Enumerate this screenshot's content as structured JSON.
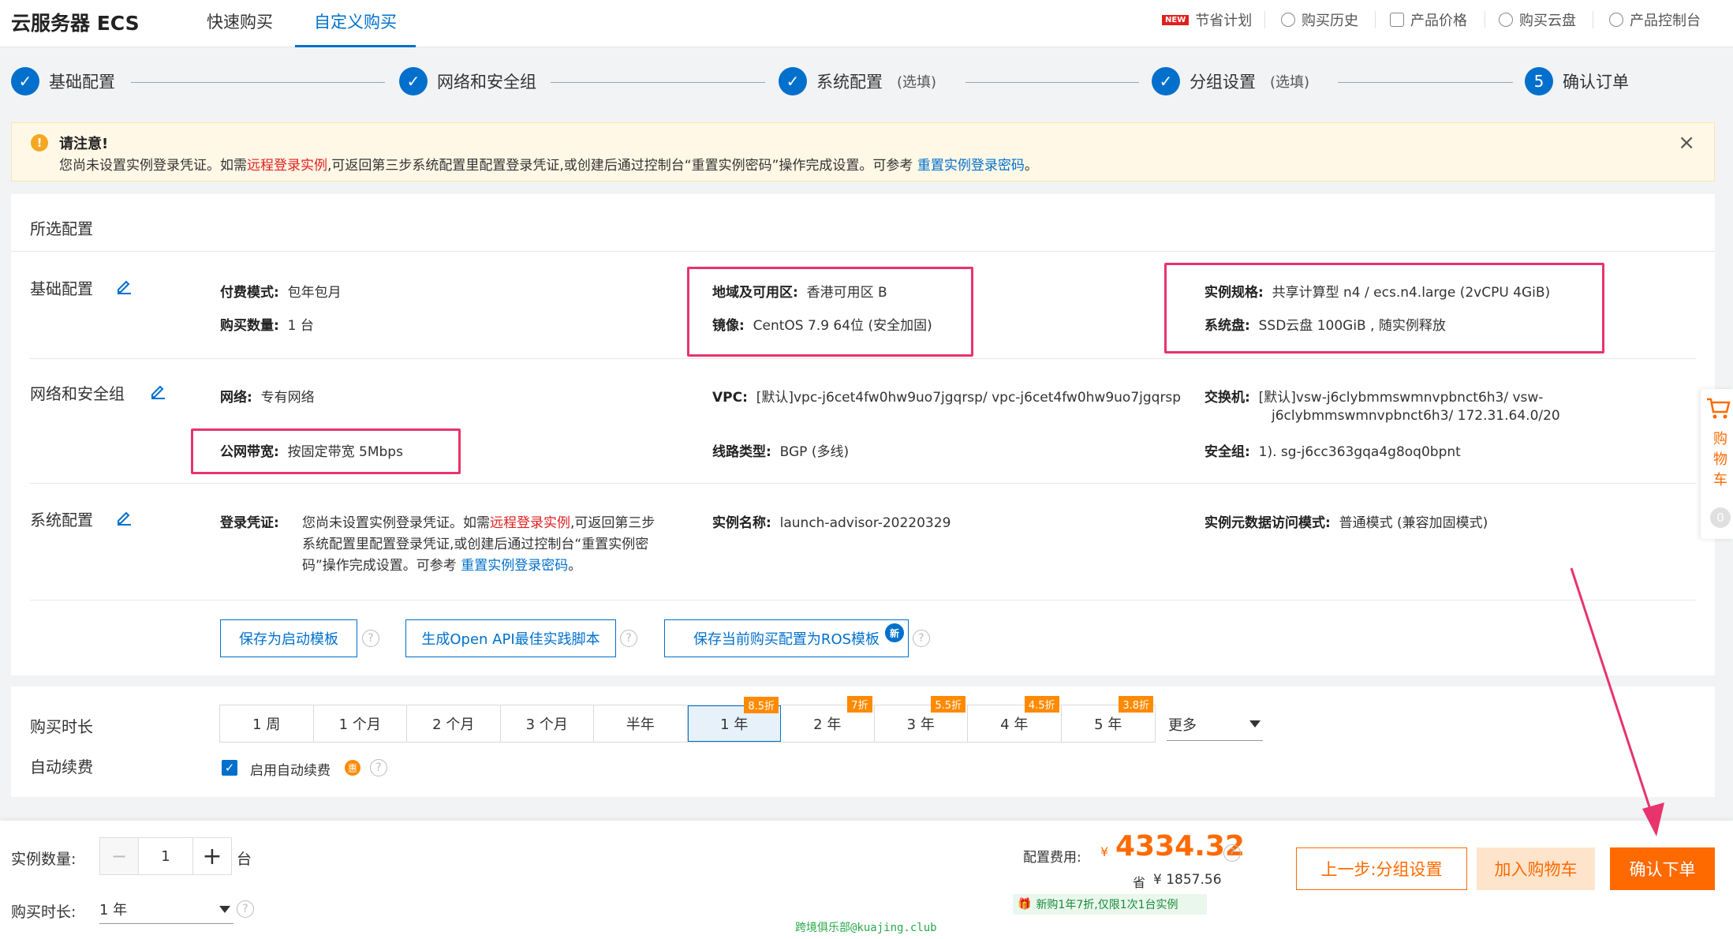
{
  "header": {
    "brand": "云服务器 ECS",
    "tabs": [
      "快速购买",
      "自定义购买"
    ],
    "nav": {
      "new_badge": "NEW",
      "save_plan": "节省计划",
      "history": "购买历史",
      "pricing": "产品价格",
      "buy_disk": "购买云盘",
      "console": "产品控制台"
    }
  },
  "steps": [
    {
      "label": "基础配置",
      "optional": ""
    },
    {
      "label": "网络和安全组",
      "optional": ""
    },
    {
      "label": "系统配置",
      "optional": "(选填)"
    },
    {
      "label": "分组设置",
      "optional": "(选填)"
    },
    {
      "label": "确认订单",
      "optional": "",
      "number": "5"
    }
  ],
  "notice": {
    "title": "请注意!",
    "body_1": "您尚未设置实例登录凭证。如需",
    "body_red": "远程登录实例",
    "body_2": ",可返回第三步系统配置里配置登录凭证,或创建后通过控制台“重置实例密码”操作完成设置。可参考 ",
    "body_link": "重置实例登录密码",
    "body_3": "。"
  },
  "summary": {
    "title": "所选配置",
    "basic": {
      "title": "基础配置",
      "pay_mode_label": "付费模式:",
      "pay_mode": "包年包月",
      "quantity_label": "购买数量:",
      "quantity": "1 台",
      "region_label": "地域及可用区:",
      "region": "香港可用区 B",
      "image_label": "镜像:",
      "image": "CentOS 7.9 64位 (安全加固)",
      "spec_label": "实例规格:",
      "spec": "共享计算型 n4 / ecs.n4.large (2vCPU 4GiB)",
      "disk_label": "系统盘:",
      "disk": "SSD云盘 100GiB , 随实例释放"
    },
    "network": {
      "title": "网络和安全组",
      "net_label": "网络:",
      "net": "专有网络",
      "vpc_label": "VPC:",
      "vpc": "[默认]vpc-j6cet4fw0hw9uo7jgqrsp/ vpc-j6cet4fw0hw9uo7jgqrsp",
      "switch_label": "交换机:",
      "switch_1": "[默认]vsw-j6clybmmswmnvpbnct6h3/ vsw-",
      "switch_2": "j6clybmmswmnvpbnct6h3/ 172.31.64.0/20",
      "bandwidth_label": "公网带宽:",
      "bandwidth": "按固定带宽 5Mbps",
      "line_label": "线路类型:",
      "line": "BGP (多线)",
      "sg_label": "安全组:",
      "sg": "1). sg-j6cc363gqa4g8oq0bpnt"
    },
    "system": {
      "title": "系统配置",
      "cred_label": "登录凭证:",
      "cred_1": "您尚未设置实例登录凭证。如需",
      "cred_red": "远程登录实例",
      "cred_2": ",可返回第三步",
      "cred_3": "系统配置里配置登录凭证,或创建后通过控制台“重置实例密",
      "cred_4": "码”操作完成设置。可参考 ",
      "cred_link": "重置实例登录密码",
      "cred_5": "。",
      "name_label": "实例名称:",
      "name": "launch-advisor-20220329",
      "meta_label": "实例元数据访问模式:",
      "meta": "普通模式 (兼容加固模式)"
    },
    "buttons": {
      "save_template": "保存为启动模板",
      "gen_api": "生成Open API最佳实践脚本",
      "save_ros": "保存当前购买配置为ROS模板",
      "new_badge": "新"
    }
  },
  "duration": {
    "label": "购买时长",
    "options": [
      {
        "label": "1 周",
        "discount": ""
      },
      {
        "label": "1 个月",
        "discount": ""
      },
      {
        "label": "2 个月",
        "discount": ""
      },
      {
        "label": "3 个月",
        "discount": ""
      },
      {
        "label": "半年",
        "discount": ""
      },
      {
        "label": "1 年",
        "discount": "8.5折"
      },
      {
        "label": "2 年",
        "discount": "7折"
      },
      {
        "label": "3 年",
        "discount": "5.5折"
      },
      {
        "label": "4 年",
        "discount": "4.5折"
      },
      {
        "label": "5 年",
        "discount": "3.8折"
      }
    ],
    "selected_index": 5,
    "more": "更多",
    "auto_renew_label": "自动续费",
    "auto_renew_option": "启用自动续费",
    "auto_renew_checked": true,
    "hui": "惠"
  },
  "bottom": {
    "qty_label": "实例数量:",
    "qty_value": "1",
    "qty_unit": "台",
    "dur_label": "购买时长:",
    "dur_value": "1 年",
    "fee_label": "配置费用:",
    "currency": "¥",
    "price": "4334.32",
    "save_label": "省",
    "save_value": "¥ 1857.56",
    "promo": "新购1年7折,仅限1次1台实例",
    "prev_btn": "上一步:分组设置",
    "cart_btn": "加入购物车",
    "confirm_btn": "确认下单"
  },
  "cart": {
    "label": "购物车",
    "count": "0"
  },
  "watermark": "跨境俱乐部@kuajing.club",
  "colors": {
    "primary": "#0070cc",
    "accent": "#ff6a00",
    "highlight": "#e8336d"
  }
}
